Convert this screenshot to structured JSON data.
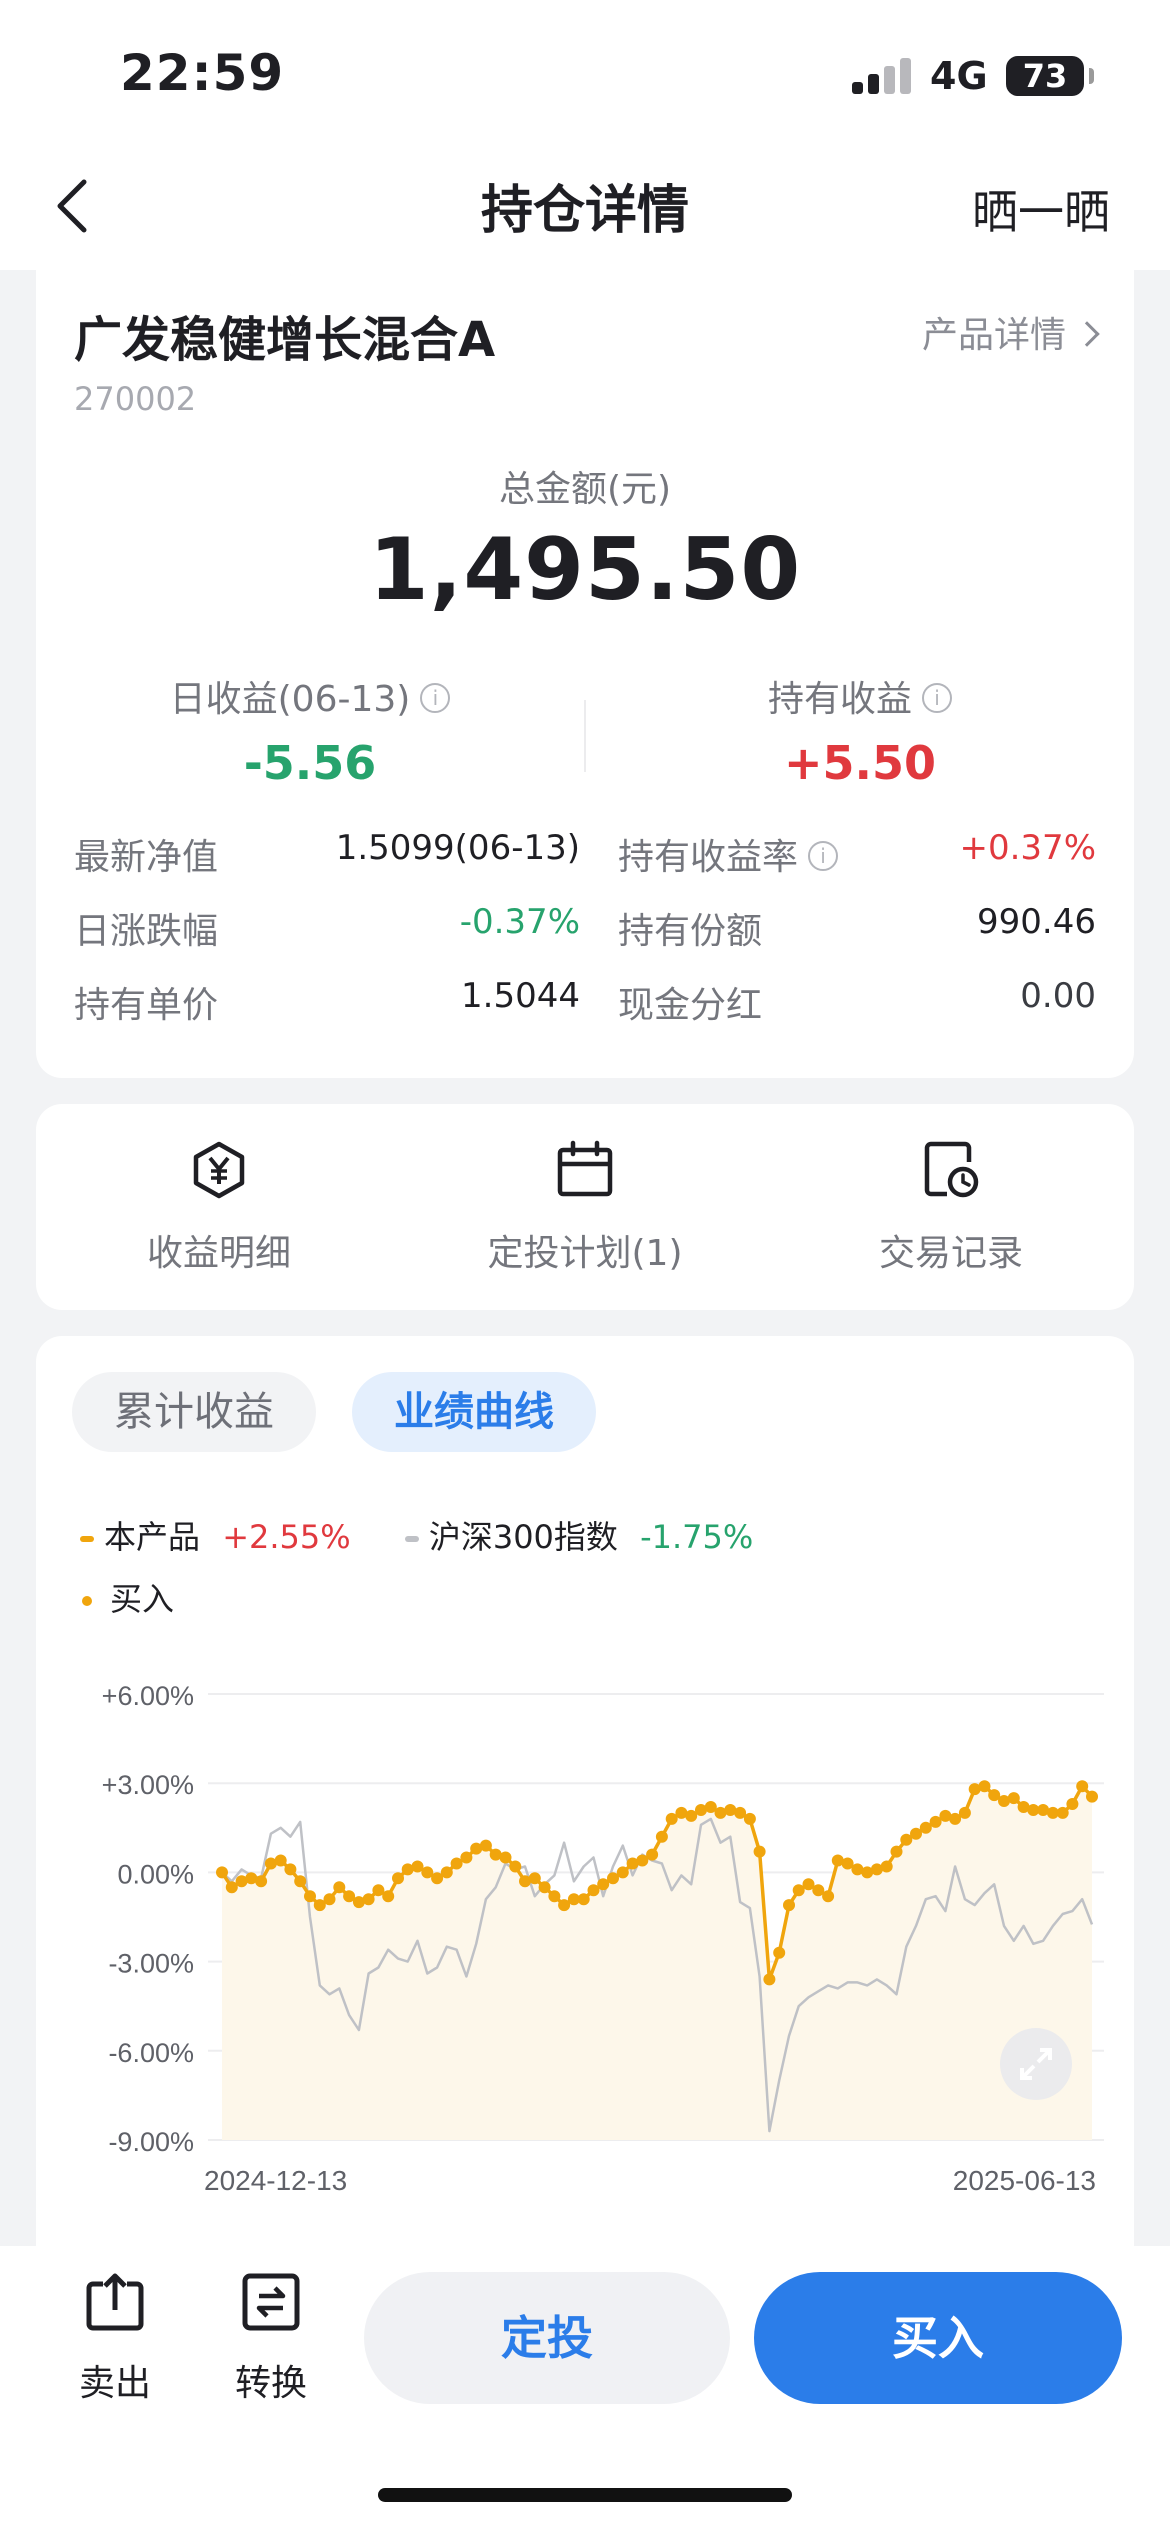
{
  "status": {
    "time": "22:59",
    "network": "4G",
    "battery": "73"
  },
  "nav": {
    "title": "持仓详情",
    "share": "晒一晒"
  },
  "fund": {
    "name": "广发稳健增长混合A",
    "code": "270002",
    "product_detail": "产品详情",
    "total_label": "总金额(元)",
    "total_value": "1,495.50",
    "daily_label": "日收益(06-13)",
    "daily_value": "-5.56",
    "hold_label": "持有收益",
    "hold_value": "+5.50",
    "rows": [
      {
        "k1": "最新净值",
        "v1": "1.5099(06-13)",
        "k2": "持有收益率",
        "v2": "+0.37%"
      },
      {
        "k1": "日涨跌幅",
        "v1": "-0.37%",
        "k2": "持有份额",
        "v2": "990.46"
      },
      {
        "k1": "持有单价",
        "v1": "1.5044",
        "k2": "现金分红",
        "v2": "0.00"
      }
    ],
    "info_icon": "i"
  },
  "actions": [
    {
      "label": "收益明细",
      "icon": "yuan-hexagon-icon"
    },
    {
      "label": "定投计划(1)",
      "icon": "calendar-icon"
    },
    {
      "label": "交易记录",
      "icon": "record-clock-icon"
    }
  ],
  "perf": {
    "tab1": "累计收益",
    "tab2": "业绩曲线",
    "legend_product": "本产品",
    "legend_product_value": "+2.55%",
    "legend_index": "沪深300指数",
    "legend_index_value": "-1.75%",
    "legend_buy": "买入"
  },
  "colors": {
    "accent": "#2b7de9",
    "up": "#e0393e",
    "down": "#27a36d",
    "product_line": "#f0a50d",
    "index_line": "#bfc1c6"
  },
  "chart_data": {
    "type": "line",
    "x_start": "2024-12-13",
    "x_end": "2025-06-13",
    "ylim": [
      -9,
      6
    ],
    "yticks": [
      "+6.00%",
      "+3.00%",
      "0.00%",
      "-3.00%",
      "-6.00%",
      "-9.00%"
    ],
    "series": [
      {
        "name": "本产品",
        "values": [
          0.0,
          -0.5,
          -0.3,
          -0.2,
          -0.3,
          0.3,
          0.4,
          0.1,
          -0.3,
          -0.8,
          -1.1,
          -0.9,
          -0.5,
          -0.8,
          -1.0,
          -0.9,
          -0.6,
          -0.8,
          -0.2,
          0.1,
          0.2,
          0.0,
          -0.2,
          0.0,
          0.3,
          0.5,
          0.8,
          0.9,
          0.6,
          0.5,
          0.2,
          -0.3,
          -0.2,
          -0.5,
          -0.8,
          -1.1,
          -0.9,
          -0.9,
          -0.6,
          -0.4,
          -0.2,
          0.0,
          0.3,
          0.4,
          0.6,
          1.2,
          1.8,
          2.0,
          1.9,
          2.1,
          2.2,
          2.0,
          2.1,
          2.0,
          1.8,
          0.7,
          -3.6,
          -2.7,
          -1.1,
          -0.6,
          -0.4,
          -0.6,
          -0.8,
          0.4,
          0.3,
          0.1,
          0.0,
          0.1,
          0.2,
          0.7,
          1.1,
          1.3,
          1.5,
          1.7,
          1.9,
          1.8,
          2.0,
          2.8,
          2.9,
          2.6,
          2.4,
          2.5,
          2.2,
          2.1,
          2.1,
          2.0,
          2.0,
          2.3,
          2.9,
          2.55
        ]
      },
      {
        "name": "沪深300指数",
        "values": [
          0.0,
          -0.3,
          0.1,
          -0.1,
          -0.2,
          1.3,
          1.5,
          1.2,
          1.7,
          -1.5,
          -3.8,
          -4.1,
          -3.9,
          -4.8,
          -5.3,
          -3.4,
          -3.2,
          -2.6,
          -2.9,
          -3.0,
          -2.3,
          -3.4,
          -3.2,
          -2.5,
          -2.6,
          -3.5,
          -2.4,
          -0.9,
          -0.5,
          0.3,
          0.1,
          0.2,
          -0.8,
          -0.4,
          -0.1,
          1.0,
          -0.3,
          0.2,
          0.5,
          -0.8,
          0.2,
          0.9,
          -0.1,
          0.6,
          0.4,
          0.3,
          -0.6,
          -0.1,
          -0.4,
          1.6,
          1.8,
          1.0,
          1.2,
          -1.0,
          -1.2,
          -3.5,
          -8.7,
          -7.0,
          -5.5,
          -4.5,
          -4.2,
          -4.0,
          -3.8,
          -3.9,
          -3.7,
          -3.7,
          -3.8,
          -3.6,
          -3.8,
          -4.1,
          -2.5,
          -1.8,
          -0.9,
          -0.8,
          -1.3,
          0.2,
          -0.9,
          -1.1,
          -0.7,
          -0.4,
          -1.8,
          -2.3,
          -1.8,
          -2.4,
          -2.3,
          -1.8,
          -1.4,
          -1.3,
          -0.9,
          -1.75
        ]
      }
    ],
    "buy_points_series": "本产品",
    "grid": true
  },
  "toolbar": {
    "sell": "卖出",
    "convert": "转换",
    "sip": "定投",
    "buy": "买入"
  }
}
